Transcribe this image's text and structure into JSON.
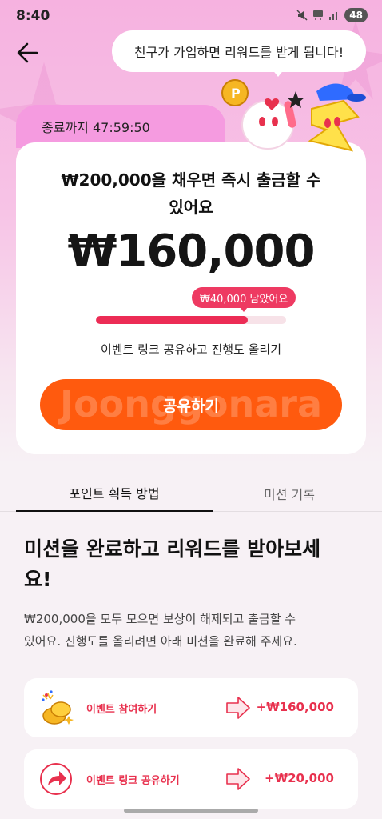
{
  "status_bar": {
    "time": "8:40",
    "battery": "48",
    "icons": [
      "mute-icon",
      "5g-icon",
      "signal-icon"
    ]
  },
  "header": {
    "back_icon": "arrow-left-icon",
    "speech_bubble": "친구가 가입하면 리워드를 받게 됩니다!"
  },
  "timer": {
    "label": "종료까지 47:59:50"
  },
  "card": {
    "heading_line1": "₩200,000을 채우면 즉시 출금할 수",
    "heading_line2": "있어요",
    "amount": "₩160,000",
    "remaining_badge": "₩40,000 남았어요",
    "progress_fraction": 0.8,
    "progress_caption": "이벤트 링크 공유하고 진행도 올리기",
    "share_button": "공유하기",
    "share_watermark": "Joonggonara"
  },
  "tabs": [
    {
      "label": "포인트 획득 방법",
      "active": true
    },
    {
      "label": "미션 기록",
      "active": false
    }
  ],
  "section": {
    "title_line1": "미션을 완료하고 리워드를 받아보세",
    "title_line2": "요!",
    "desc_line1": "₩200,000을 모두 모으면 보상이 해제되고 출금할 수",
    "desc_line2": "있어요. 진행도를 올리려면 아래 미션을 완료해 주세요."
  },
  "missions": [
    {
      "icon": "coins-fireworks-icon",
      "label": "이벤트 참여하기",
      "reward": "+₩160,000"
    },
    {
      "icon": "share-arrow-icon",
      "label": "이벤트 링크 공유하기",
      "reward": "+₩20,000"
    }
  ],
  "colors": {
    "accent_red": "#ec2c55",
    "share_orange": "#ff5a0e",
    "hero_pink": "#f6b2e0",
    "timer_pink": "#f59be0"
  }
}
